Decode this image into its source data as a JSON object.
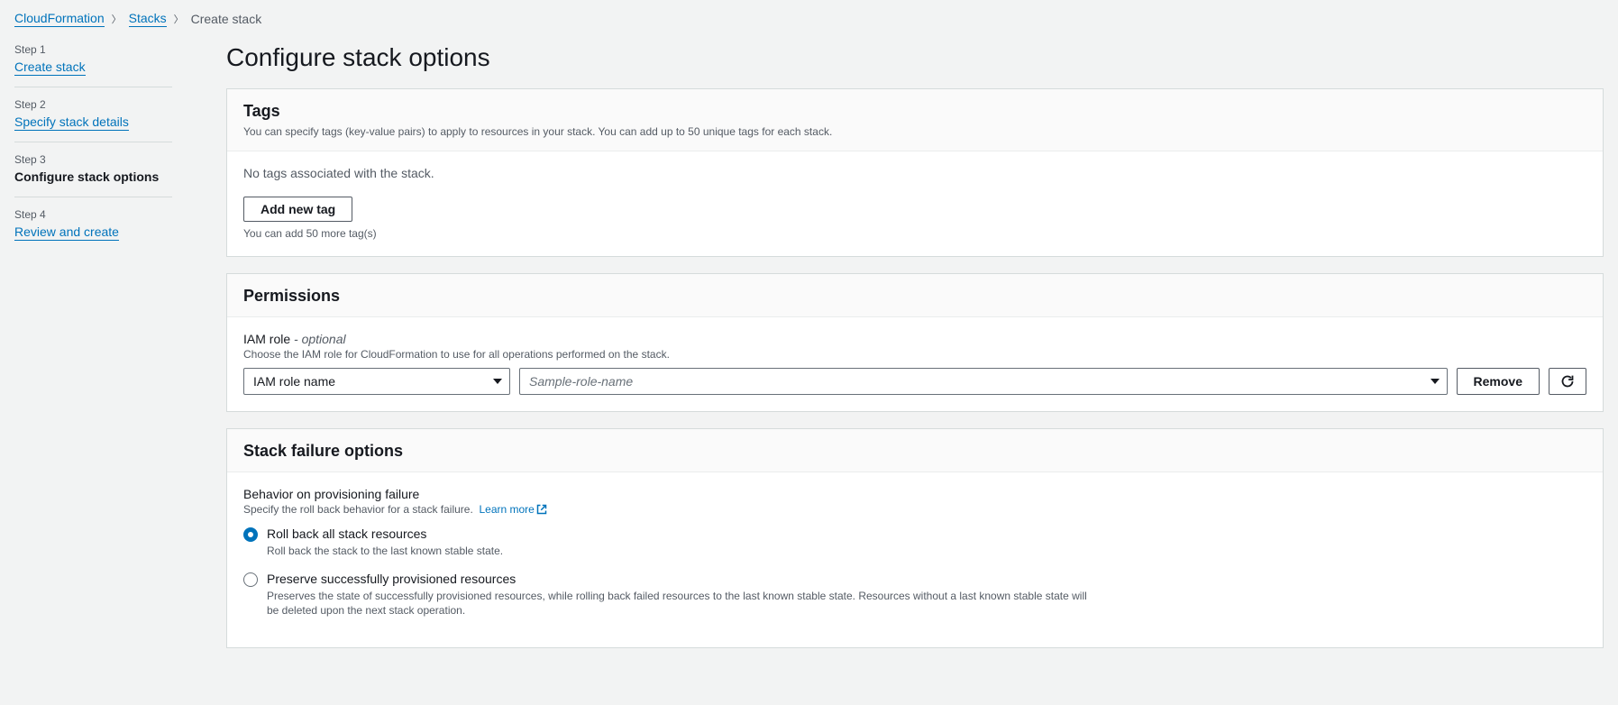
{
  "breadcrumb": {
    "items": [
      "CloudFormation",
      "Stacks",
      "Create stack"
    ]
  },
  "steps": [
    {
      "num": "Step 1",
      "label": "Create stack"
    },
    {
      "num": "Step 2",
      "label": "Specify stack details"
    },
    {
      "num": "Step 3",
      "label": "Configure stack options"
    },
    {
      "num": "Step 4",
      "label": "Review and create"
    }
  ],
  "page_title": "Configure stack options",
  "tags": {
    "title": "Tags",
    "desc": "You can specify tags (key-value pairs) to apply to resources in your stack. You can add up to 50 unique tags for each stack.",
    "empty": "No tags associated with the stack.",
    "add_btn": "Add new tag",
    "hint": "You can add 50 more tag(s)"
  },
  "permissions": {
    "title": "Permissions",
    "field_label": "IAM role",
    "field_suffix": " - optional",
    "field_desc": "Choose the IAM role for CloudFormation to use for all operations performed on the stack.",
    "select_value": "IAM role name",
    "role_placeholder": "Sample-role-name",
    "remove_btn": "Remove"
  },
  "failure": {
    "title": "Stack failure options",
    "field_label": "Behavior on provisioning failure",
    "field_desc": "Specify the roll back behavior for a stack failure.",
    "learn_more": "Learn more",
    "options": [
      {
        "label": "Roll back all stack resources",
        "desc": "Roll back the stack to the last known stable state.",
        "checked": true
      },
      {
        "label": "Preserve successfully provisioned resources",
        "desc": "Preserves the state of successfully provisioned resources, while rolling back failed resources to the last known stable state. Resources without a last known stable state will be deleted upon the next stack operation.",
        "checked": false
      }
    ]
  }
}
